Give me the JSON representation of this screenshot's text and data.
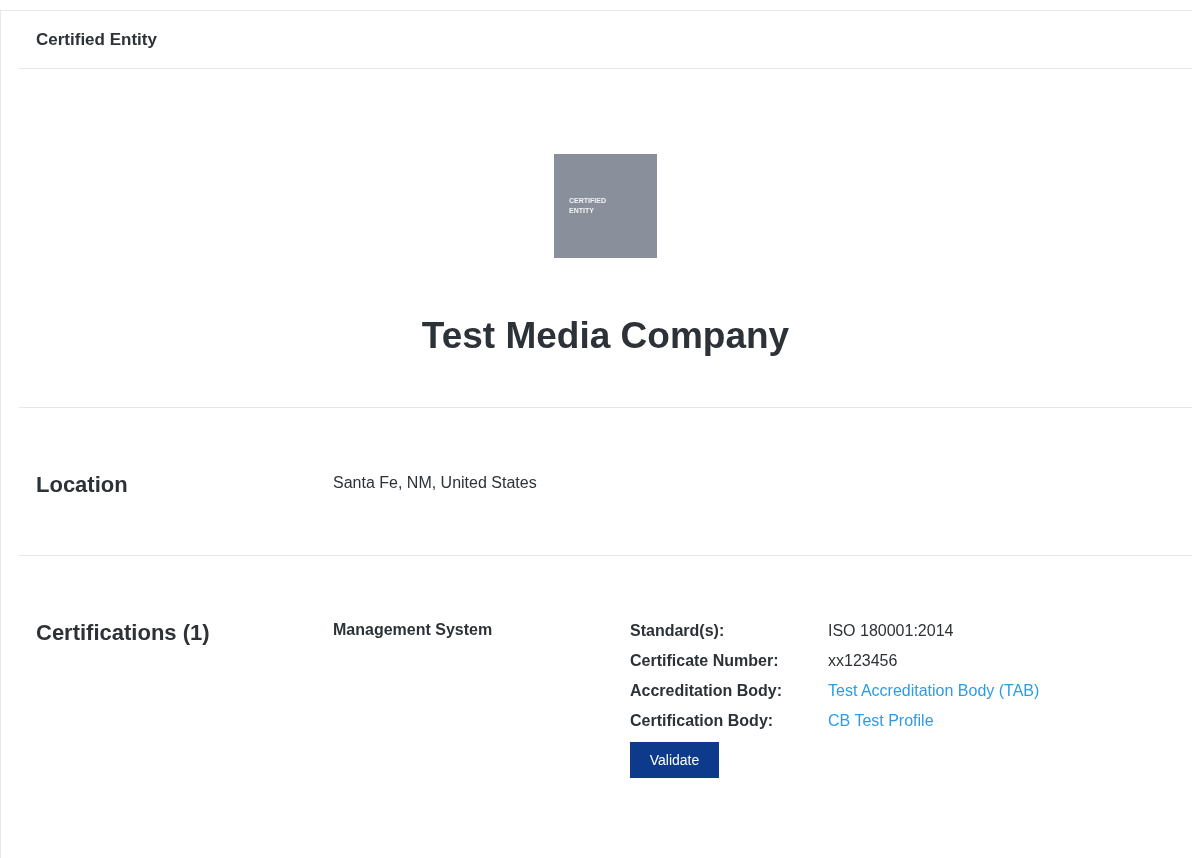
{
  "header": {
    "title": "Certified Entity"
  },
  "entity": {
    "logo_text": "CERTIFIED ENTITY",
    "name": "Test Media Company"
  },
  "location": {
    "heading": "Location",
    "value": "Santa Fe, NM, United States"
  },
  "certifications": {
    "heading": "Certifications (1)",
    "items": [
      {
        "type": "Management System",
        "details": [
          {
            "label": "Standard(s):",
            "value": "ISO 180001:2014",
            "kind": "text"
          },
          {
            "label": "Certificate Number:",
            "value": "xx123456",
            "kind": "text"
          },
          {
            "label": "Accreditation Body:",
            "value": "Test Accreditation Body (TAB)",
            "kind": "link"
          },
          {
            "label": "Certification Body:",
            "value": "CB Test Profile",
            "kind": "link"
          }
        ],
        "button": "Validate"
      }
    ]
  }
}
